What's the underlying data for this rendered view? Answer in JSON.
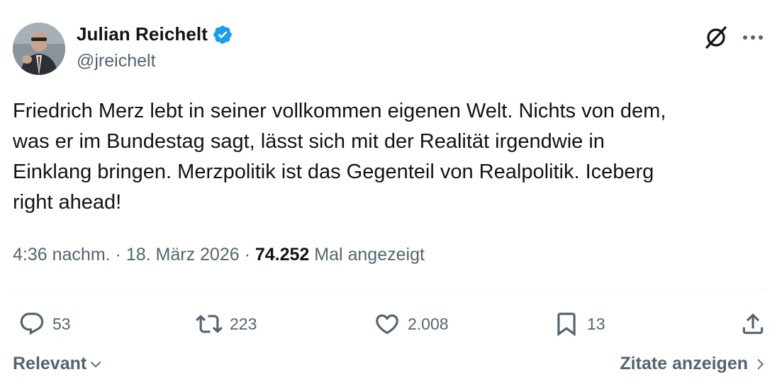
{
  "author": {
    "name": "Julian Reichelt",
    "handle": "@jreichelt",
    "verified": true,
    "verified_color": "#1d9bf0"
  },
  "tweet": {
    "text": "Friedrich Merz lebt in seiner vollkommen eigenen Welt. Nichts von dem,\nwas er im Bundestag sagt, lässt sich mit der Realität irgendwie in\nEinklang bringen. Merzpolitik ist das Gegenteil von Realpolitik. Iceberg\nright ahead!",
    "time": "4:36 nachm.",
    "separator": " · ",
    "date": "18. März 2026",
    "views_count": "74.252",
    "views_label": " Mal angezeigt"
  },
  "actions": {
    "replies": "53",
    "reposts": "223",
    "likes": "2.008",
    "bookmarks": "13"
  },
  "footer": {
    "sort_label": "Relevant",
    "quotes_label": "Zitate anzeigen"
  },
  "icons": {
    "grok": "grok-icon",
    "more": "more-icon",
    "reply": "reply-icon",
    "repost": "repost-icon",
    "like": "heart-icon",
    "bookmark": "bookmark-icon",
    "share": "share-icon"
  },
  "colors": {
    "text_primary": "#0f1419",
    "text_secondary": "#536471",
    "divider": "#eff3f4"
  }
}
